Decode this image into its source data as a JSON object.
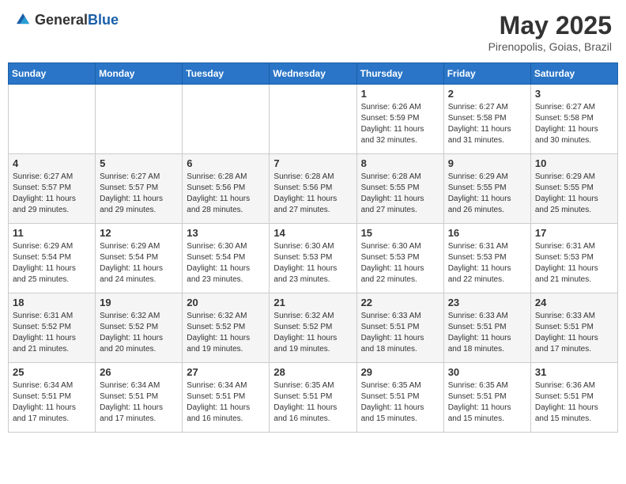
{
  "header": {
    "logo_general": "General",
    "logo_blue": "Blue",
    "month": "May 2025",
    "location": "Pirenopolis, Goias, Brazil"
  },
  "days_of_week": [
    "Sunday",
    "Monday",
    "Tuesday",
    "Wednesday",
    "Thursday",
    "Friday",
    "Saturday"
  ],
  "weeks": [
    [
      {
        "day": "",
        "info": ""
      },
      {
        "day": "",
        "info": ""
      },
      {
        "day": "",
        "info": ""
      },
      {
        "day": "",
        "info": ""
      },
      {
        "day": "1",
        "info": "Sunrise: 6:26 AM\nSunset: 5:59 PM\nDaylight: 11 hours and 32 minutes."
      },
      {
        "day": "2",
        "info": "Sunrise: 6:27 AM\nSunset: 5:58 PM\nDaylight: 11 hours and 31 minutes."
      },
      {
        "day": "3",
        "info": "Sunrise: 6:27 AM\nSunset: 5:58 PM\nDaylight: 11 hours and 30 minutes."
      }
    ],
    [
      {
        "day": "4",
        "info": "Sunrise: 6:27 AM\nSunset: 5:57 PM\nDaylight: 11 hours and 29 minutes."
      },
      {
        "day": "5",
        "info": "Sunrise: 6:27 AM\nSunset: 5:57 PM\nDaylight: 11 hours and 29 minutes."
      },
      {
        "day": "6",
        "info": "Sunrise: 6:28 AM\nSunset: 5:56 PM\nDaylight: 11 hours and 28 minutes."
      },
      {
        "day": "7",
        "info": "Sunrise: 6:28 AM\nSunset: 5:56 PM\nDaylight: 11 hours and 27 minutes."
      },
      {
        "day": "8",
        "info": "Sunrise: 6:28 AM\nSunset: 5:55 PM\nDaylight: 11 hours and 27 minutes."
      },
      {
        "day": "9",
        "info": "Sunrise: 6:29 AM\nSunset: 5:55 PM\nDaylight: 11 hours and 26 minutes."
      },
      {
        "day": "10",
        "info": "Sunrise: 6:29 AM\nSunset: 5:55 PM\nDaylight: 11 hours and 25 minutes."
      }
    ],
    [
      {
        "day": "11",
        "info": "Sunrise: 6:29 AM\nSunset: 5:54 PM\nDaylight: 11 hours and 25 minutes."
      },
      {
        "day": "12",
        "info": "Sunrise: 6:29 AM\nSunset: 5:54 PM\nDaylight: 11 hours and 24 minutes."
      },
      {
        "day": "13",
        "info": "Sunrise: 6:30 AM\nSunset: 5:54 PM\nDaylight: 11 hours and 23 minutes."
      },
      {
        "day": "14",
        "info": "Sunrise: 6:30 AM\nSunset: 5:53 PM\nDaylight: 11 hours and 23 minutes."
      },
      {
        "day": "15",
        "info": "Sunrise: 6:30 AM\nSunset: 5:53 PM\nDaylight: 11 hours and 22 minutes."
      },
      {
        "day": "16",
        "info": "Sunrise: 6:31 AM\nSunset: 5:53 PM\nDaylight: 11 hours and 22 minutes."
      },
      {
        "day": "17",
        "info": "Sunrise: 6:31 AM\nSunset: 5:53 PM\nDaylight: 11 hours and 21 minutes."
      }
    ],
    [
      {
        "day": "18",
        "info": "Sunrise: 6:31 AM\nSunset: 5:52 PM\nDaylight: 11 hours and 21 minutes."
      },
      {
        "day": "19",
        "info": "Sunrise: 6:32 AM\nSunset: 5:52 PM\nDaylight: 11 hours and 20 minutes."
      },
      {
        "day": "20",
        "info": "Sunrise: 6:32 AM\nSunset: 5:52 PM\nDaylight: 11 hours and 19 minutes."
      },
      {
        "day": "21",
        "info": "Sunrise: 6:32 AM\nSunset: 5:52 PM\nDaylight: 11 hours and 19 minutes."
      },
      {
        "day": "22",
        "info": "Sunrise: 6:33 AM\nSunset: 5:51 PM\nDaylight: 11 hours and 18 minutes."
      },
      {
        "day": "23",
        "info": "Sunrise: 6:33 AM\nSunset: 5:51 PM\nDaylight: 11 hours and 18 minutes."
      },
      {
        "day": "24",
        "info": "Sunrise: 6:33 AM\nSunset: 5:51 PM\nDaylight: 11 hours and 17 minutes."
      }
    ],
    [
      {
        "day": "25",
        "info": "Sunrise: 6:34 AM\nSunset: 5:51 PM\nDaylight: 11 hours and 17 minutes."
      },
      {
        "day": "26",
        "info": "Sunrise: 6:34 AM\nSunset: 5:51 PM\nDaylight: 11 hours and 17 minutes."
      },
      {
        "day": "27",
        "info": "Sunrise: 6:34 AM\nSunset: 5:51 PM\nDaylight: 11 hours and 16 minutes."
      },
      {
        "day": "28",
        "info": "Sunrise: 6:35 AM\nSunset: 5:51 PM\nDaylight: 11 hours and 16 minutes."
      },
      {
        "day": "29",
        "info": "Sunrise: 6:35 AM\nSunset: 5:51 PM\nDaylight: 11 hours and 15 minutes."
      },
      {
        "day": "30",
        "info": "Sunrise: 6:35 AM\nSunset: 5:51 PM\nDaylight: 11 hours and 15 minutes."
      },
      {
        "day": "31",
        "info": "Sunrise: 6:36 AM\nSunset: 5:51 PM\nDaylight: 11 hours and 15 minutes."
      }
    ]
  ]
}
